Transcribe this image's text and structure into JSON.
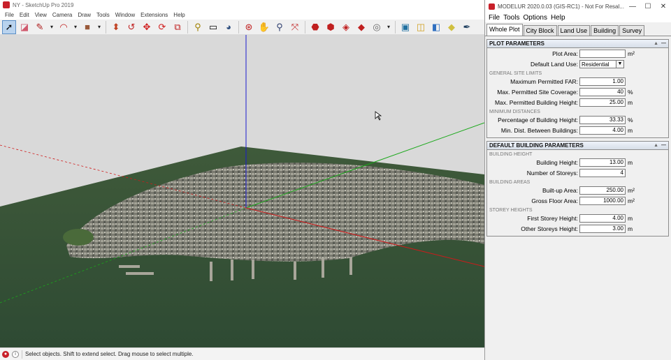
{
  "sketchup": {
    "window_title": "NY - SketchUp Pro 2019",
    "menu": [
      "File",
      "Edit",
      "View",
      "Camera",
      "Draw",
      "Tools",
      "Window",
      "Extensions",
      "Help"
    ],
    "toolbar_icons": [
      "select-icon",
      "eraser-icon",
      "pencil-icon",
      "arc-icon",
      "shape-icon",
      "pushpull-icon",
      "followme-icon",
      "move-icon",
      "rotate-icon",
      "scale-icon",
      "tape-icon",
      "text-icon",
      "paint-icon",
      "orbit-icon",
      "pan-icon",
      "zoom-icon",
      "zoom-extents-icon",
      "3dwarehouse-icon",
      "extension-warehouse-icon",
      "layout-icon",
      "ruby-icon",
      "account-icon",
      "section-icon",
      "box-icon",
      "sandbox-icon",
      "texture-icon",
      "eyedropper-icon"
    ],
    "status": "Select objects. Shift to extend select. Drag mouse to select multiple.",
    "axis_colors": {
      "blue": "#1a1ad0",
      "green": "#1aa81a",
      "red": "#d01a1a"
    }
  },
  "modelur": {
    "window_title": "MODELUR 2020.0.03 (GIS-RC1) - Not For Resal...",
    "menu": [
      "File",
      "Tools",
      "Options",
      "Help"
    ],
    "tabs": [
      "Whole Plot",
      "City Block",
      "Land Use",
      "Building",
      "Survey"
    ],
    "active_tab": "Whole Plot",
    "plot": {
      "title": "PLOT PARAMETERS",
      "plot_area": {
        "label": "Plot Area:",
        "value": "",
        "unit": "m²"
      },
      "land_use": {
        "label": "Default Land Use:",
        "value": "Residential"
      },
      "general_limits": "GENERAL SITE LIMITS",
      "max_far": {
        "label": "Maximum Permitted FAR:",
        "value": "1.00",
        "unit": ""
      },
      "max_coverage": {
        "label": "Max. Permitted Site Coverage:",
        "value": "40",
        "unit": "%"
      },
      "max_height": {
        "label": "Max. Permitted Building Height:",
        "value": "25.00",
        "unit": "m"
      },
      "min_distances": "MINIMUM DISTANCES",
      "pct_height": {
        "label": "Percentage of Building Height:",
        "value": "33.33",
        "unit": "%"
      },
      "min_dist": {
        "label": "Min. Dist. Between Buildings:",
        "value": "4.00",
        "unit": "m"
      }
    },
    "building": {
      "title": "DEFAULT BUILDING PARAMETERS",
      "height_section": "BUILDING HEIGHT",
      "building_height": {
        "label": "Building Height:",
        "value": "13.00",
        "unit": "m"
      },
      "storeys": {
        "label": "Number of Storeys:",
        "value": "4",
        "unit": ""
      },
      "areas_section": "BUILDING AREAS",
      "builtup": {
        "label": "Built-up Area:",
        "value": "250.00",
        "unit": "m²"
      },
      "gfa": {
        "label": "Gross Floor Area:",
        "value": "1000.00",
        "unit": "m²"
      },
      "storey_section": "STOREY HEIGHTS",
      "first_storey": {
        "label": "First Storey Height:",
        "value": "4.00",
        "unit": "m"
      },
      "other_storeys": {
        "label": "Other Storeys Height:",
        "value": "3.00",
        "unit": "m"
      }
    }
  }
}
